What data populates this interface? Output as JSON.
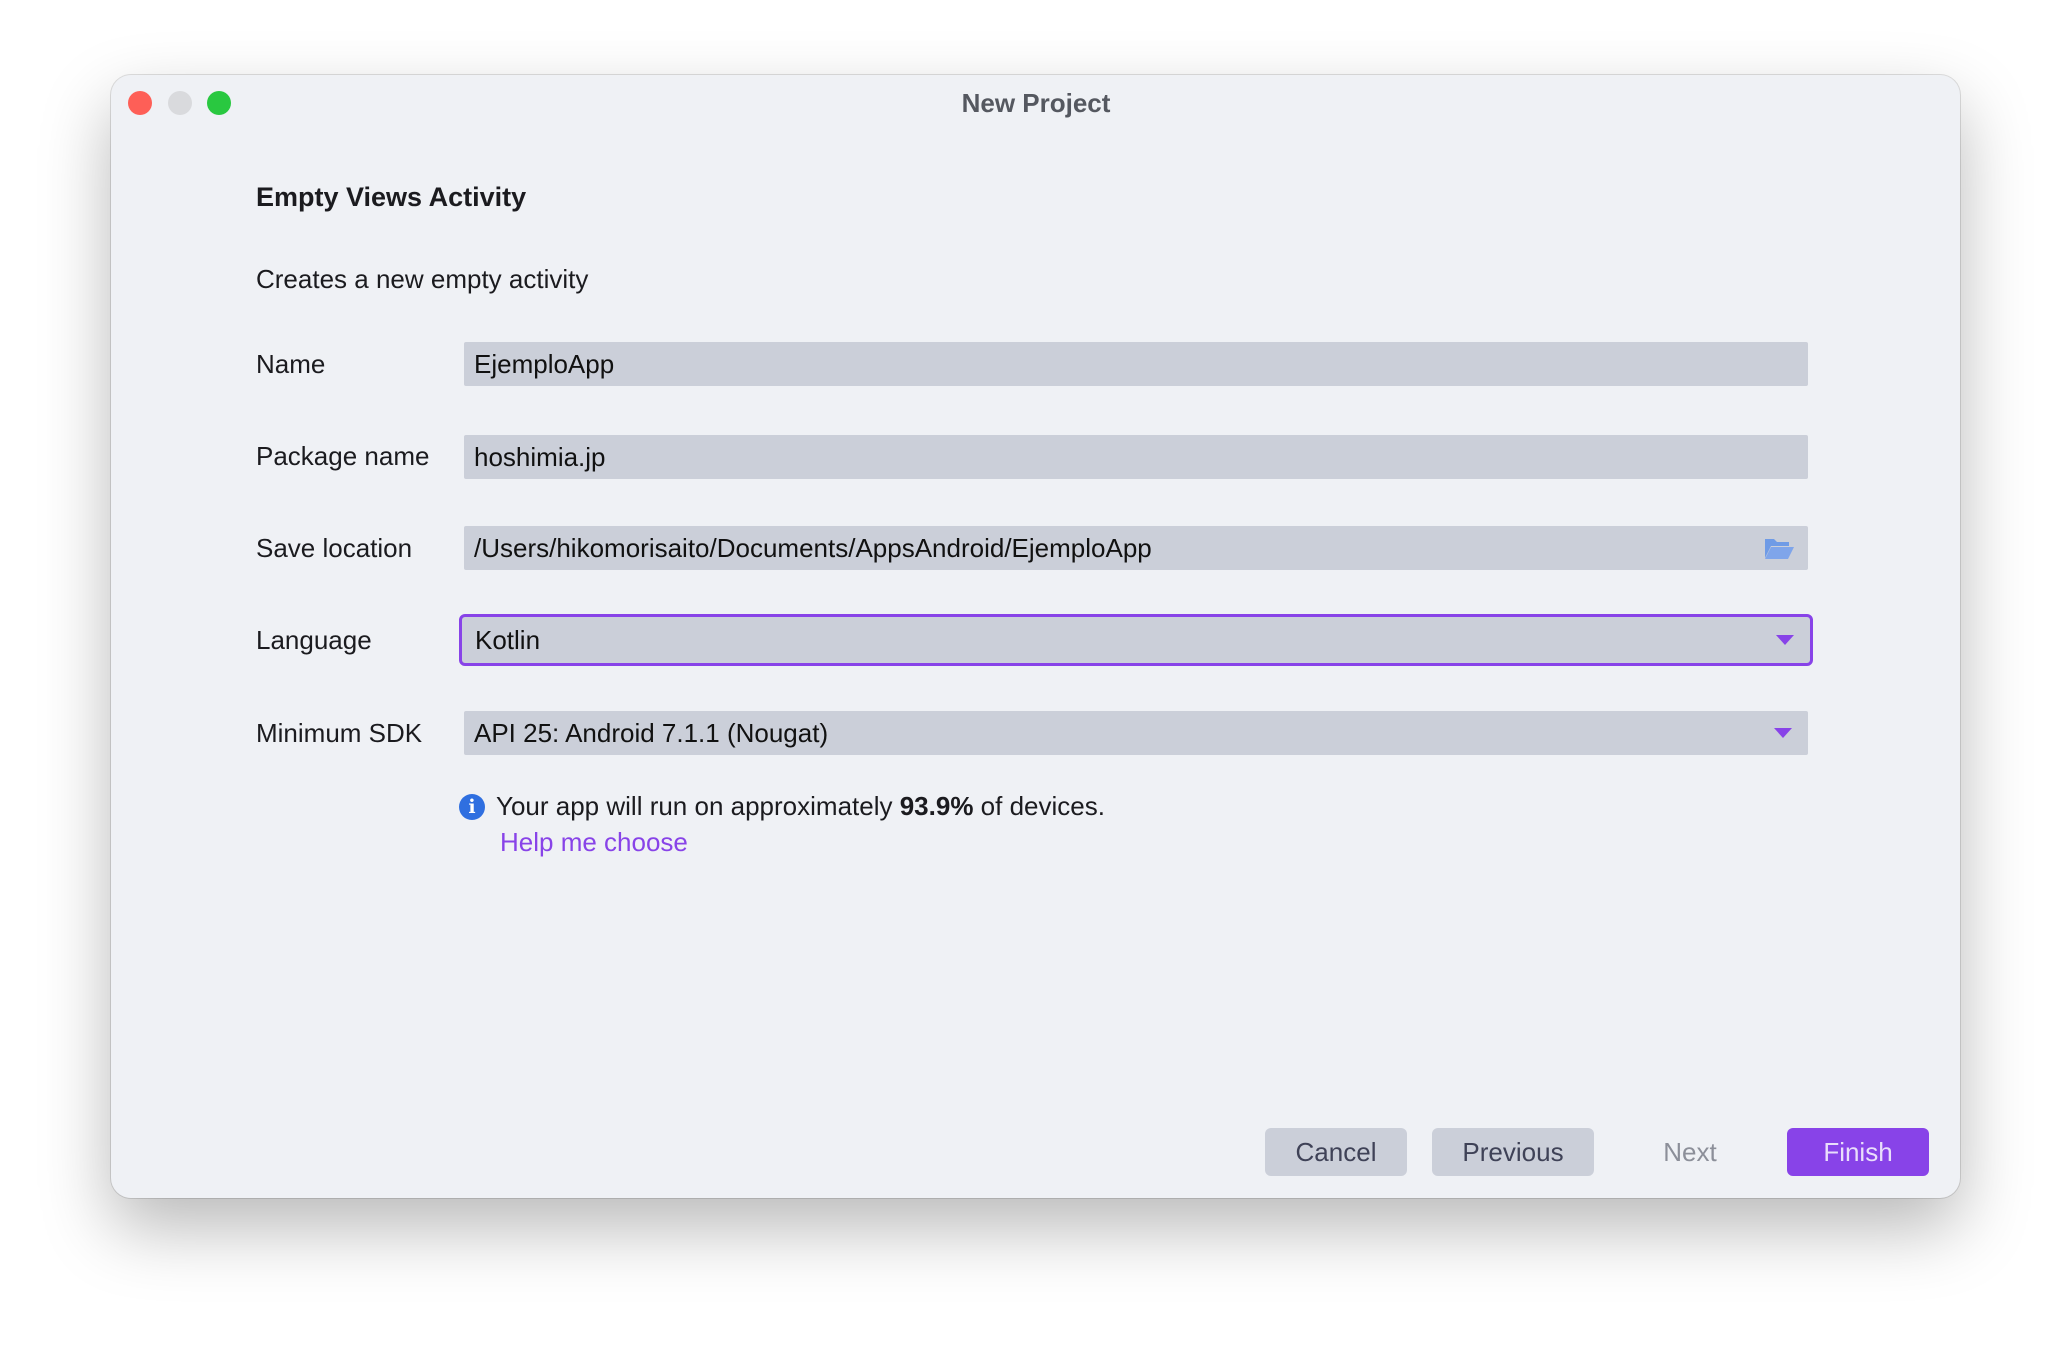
{
  "window": {
    "title": "New Project"
  },
  "header": {
    "title": "Empty Views Activity",
    "description": "Creates a new empty activity"
  },
  "form": {
    "name": {
      "label": "Name",
      "value": "EjemploApp"
    },
    "package": {
      "label": "Package name",
      "value": "hoshimia.jp"
    },
    "location": {
      "label": "Save location",
      "value": "/Users/hikomorisaito/Documents/AppsAndroid/EjemploApp",
      "icon": "folder-open-icon"
    },
    "language": {
      "label": "Language",
      "value": "Kotlin"
    },
    "min_sdk": {
      "label": "Minimum SDK",
      "value": "API 25: Android 7.1.1 (Nougat)"
    }
  },
  "info": {
    "prefix": "Your app will run on approximately ",
    "percent": "93.9%",
    "suffix": " of devices.",
    "help_link": "Help me choose"
  },
  "buttons": {
    "cancel": "Cancel",
    "previous": "Previous",
    "next": "Next",
    "finish": "Finish"
  },
  "colors": {
    "accent": "#8843e8",
    "field_bg": "#cbcfd9",
    "window_bg": "#eff1f5",
    "info": "#2f6fe0"
  }
}
